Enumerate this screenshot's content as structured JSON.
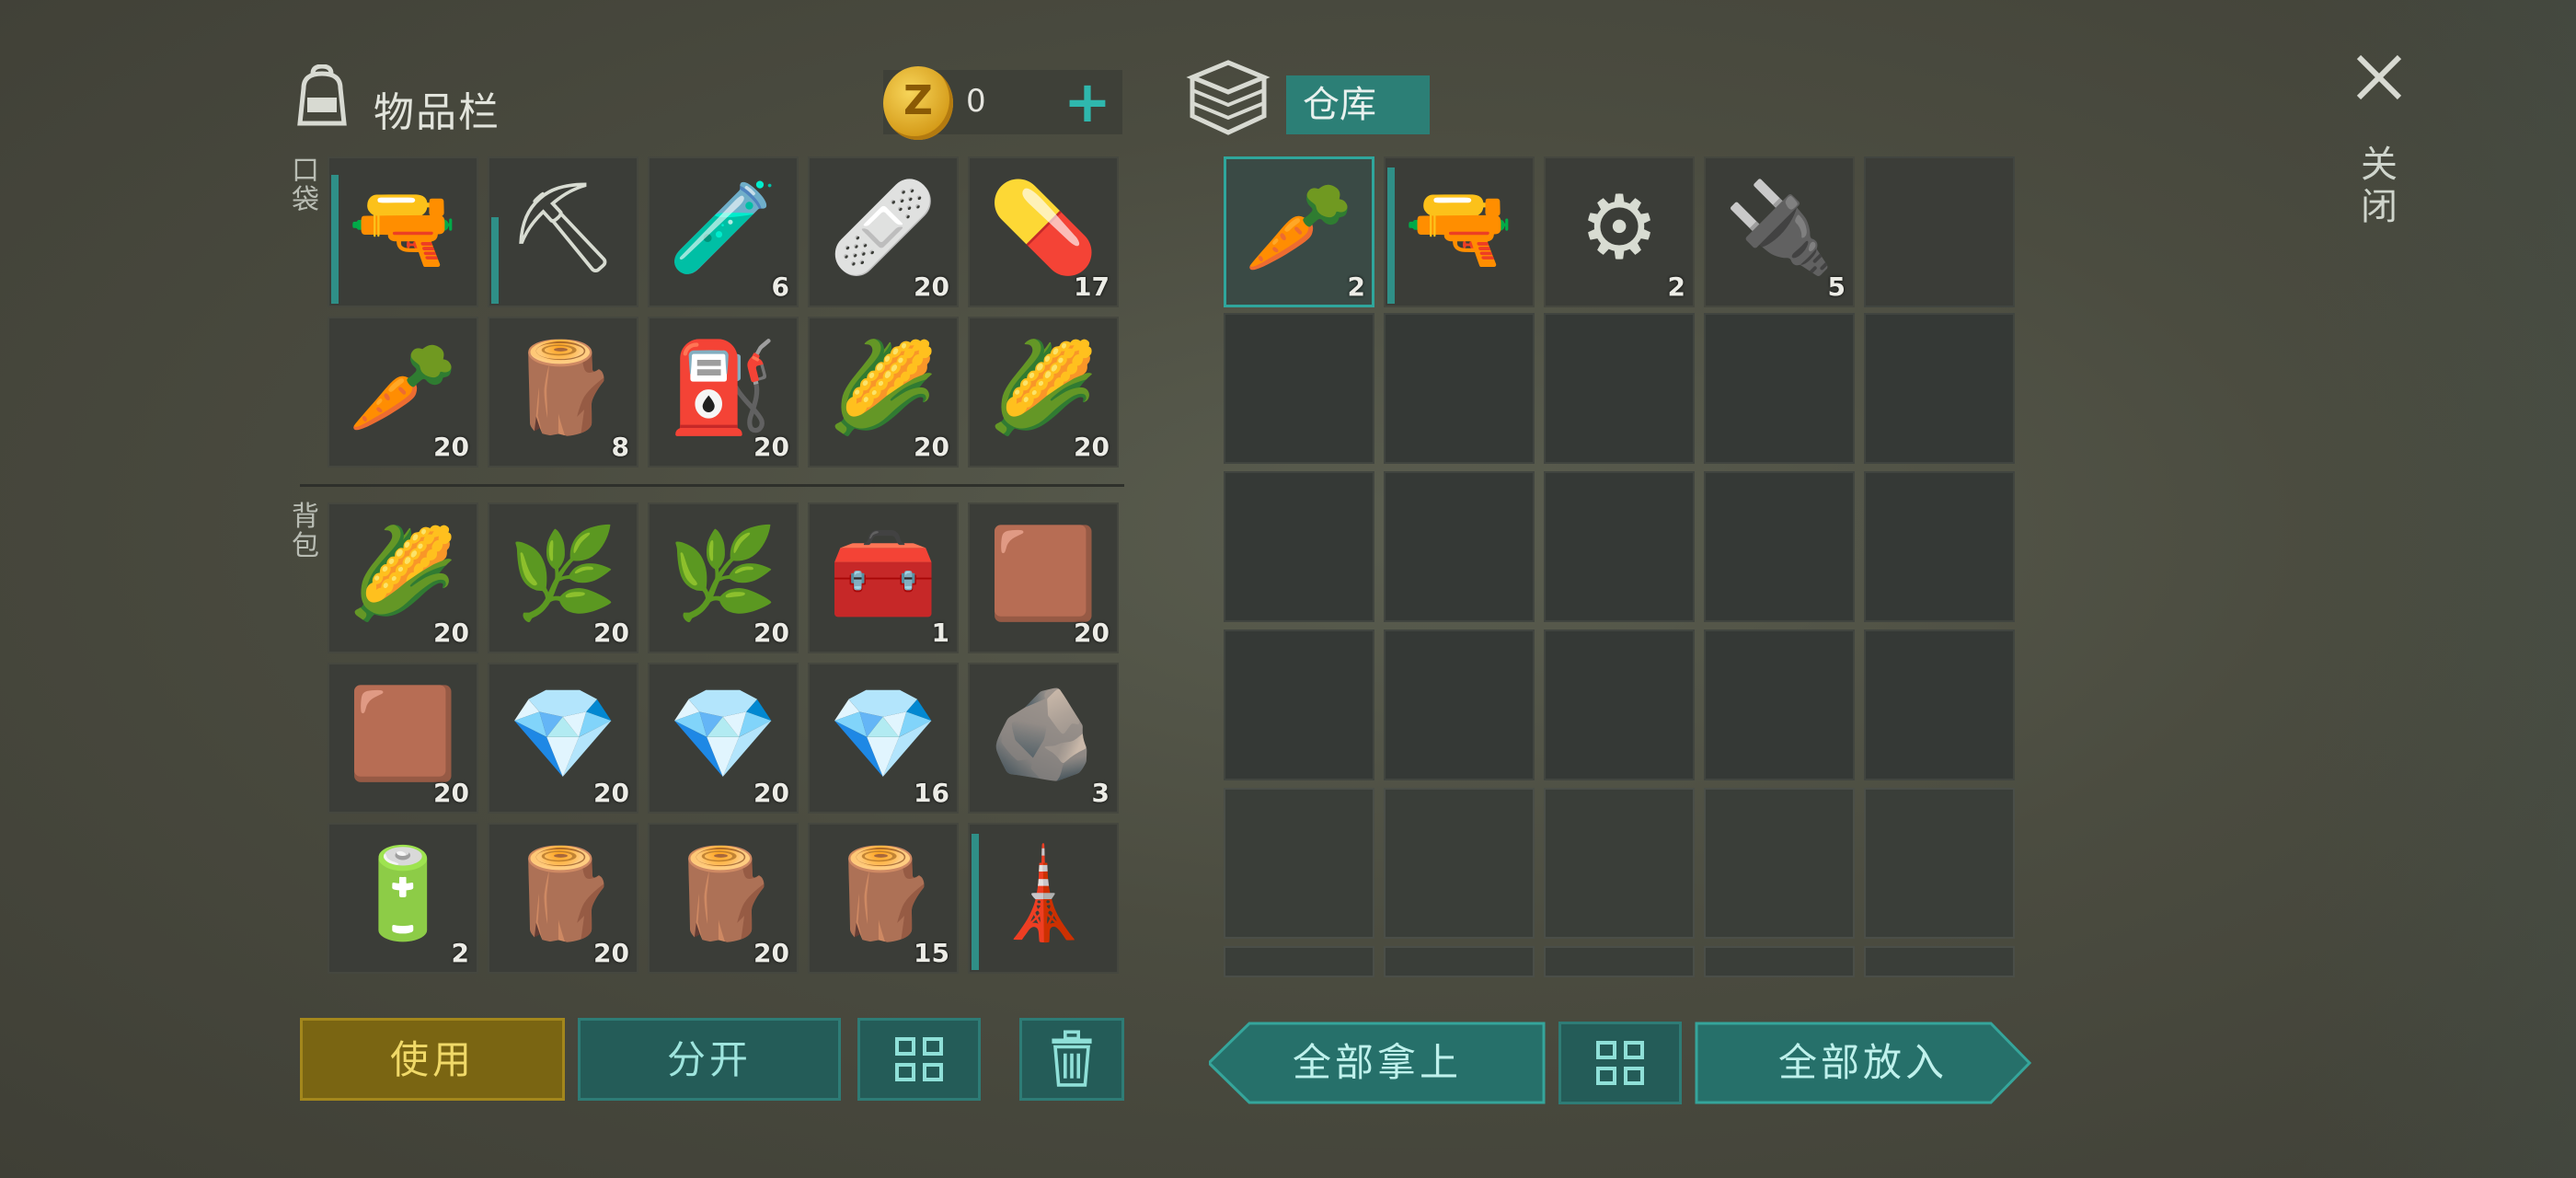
{
  "inventory": {
    "title": "物品栏",
    "coins": "0",
    "coin_symbol": "Z",
    "pocket_label": "口袋",
    "backpack_label": "背包",
    "pocket_slots": [
      {
        "icon": "pistol-icon",
        "count": "",
        "durability": 0.9
      },
      {
        "icon": "pickaxe-icon",
        "count": "",
        "durability": 0.6
      },
      {
        "icon": "vial-icon",
        "count": "6"
      },
      {
        "icon": "bandage-icon",
        "count": "20"
      },
      {
        "icon": "pills-icon",
        "count": "17"
      },
      {
        "icon": "carrot-icon",
        "count": "20"
      },
      {
        "icon": "wood-plank-icon",
        "count": "8"
      },
      {
        "icon": "fuel-can-icon",
        "count": "20"
      },
      {
        "icon": "corn-seed-icon",
        "count": "20"
      },
      {
        "icon": "corn-seed-icon",
        "count": "20"
      }
    ],
    "backpack_slots": [
      {
        "icon": "corn-seed-icon",
        "count": "20"
      },
      {
        "icon": "leaf-icon",
        "count": "20"
      },
      {
        "icon": "leaf-icon",
        "count": "20"
      },
      {
        "icon": "toolbox-icon",
        "count": "1"
      },
      {
        "icon": "hide-icon",
        "count": "20"
      },
      {
        "icon": "hide-icon",
        "count": "20"
      },
      {
        "icon": "crystal-icon",
        "count": "20"
      },
      {
        "icon": "crystal-icon",
        "count": "20"
      },
      {
        "icon": "crystal-icon",
        "count": "16"
      },
      {
        "icon": "ore-icon",
        "count": "3"
      },
      {
        "icon": "battery-icon",
        "count": "2"
      },
      {
        "icon": "log-icon",
        "count": "20"
      },
      {
        "icon": "log-icon",
        "count": "20"
      },
      {
        "icon": "log-icon",
        "count": "15"
      },
      {
        "icon": "turret-icon",
        "count": "",
        "durability": 0.95
      }
    ],
    "buttons": {
      "use": "使用",
      "split": "分开"
    }
  },
  "storage": {
    "tab_label": "仓库",
    "slots": [
      {
        "icon": "carrot-icon",
        "count": "2",
        "selected": true
      },
      {
        "icon": "blaster-icon",
        "count": "",
        "durability": 0.95
      },
      {
        "icon": "steel-icon",
        "count": "2"
      },
      {
        "icon": "transistor-icon",
        "count": "5"
      }
    ],
    "buttons": {
      "take_all": "全部拿上",
      "put_all": "全部放入"
    }
  },
  "close_label": "关闭",
  "colors": {
    "accent": "#2fa69c",
    "use_button": "#7a6512",
    "panel_bg": "#3b3d38"
  }
}
